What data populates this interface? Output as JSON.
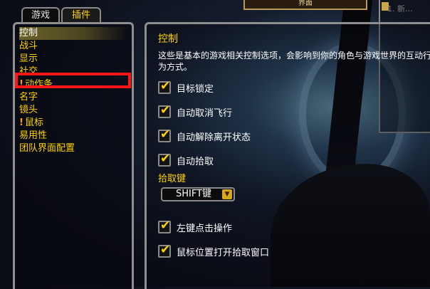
{
  "top_strip": {
    "center_label": "界面",
    "mini_frame_title": "1. 新..."
  },
  "tabs": [
    {
      "label": "游戏"
    },
    {
      "label": "插件"
    }
  ],
  "categories": [
    {
      "label": "控制"
    },
    {
      "label": "战斗"
    },
    {
      "label": "显示"
    },
    {
      "label": "社交"
    },
    {
      "label": "动作条"
    },
    {
      "label": "名字"
    },
    {
      "label": "镜头"
    },
    {
      "label": "鼠标"
    },
    {
      "label": "易用性"
    },
    {
      "label": "团队界面配置"
    }
  ],
  "warning_glyph": "!",
  "panel": {
    "title": "控制",
    "description": "这些是基本的游戏相关控制选项，会影响到你的角色与游戏世界的互动行为方式。",
    "options": [
      {
        "label": "目标锁定",
        "checked": true
      },
      {
        "label": "自动取消飞行",
        "checked": true
      },
      {
        "label": "自动解除离开状态",
        "checked": true
      },
      {
        "label": "自动拾取",
        "checked": true
      }
    ],
    "loot_key_label": "拾取键",
    "loot_key_value": "SHIFT键",
    "options2": [
      {
        "label": "左键点击操作",
        "checked": true
      },
      {
        "label": "鼠标位置打开拾取窗口",
        "checked": true
      }
    ]
  },
  "colors": {
    "accent": "#ffd200",
    "highlight_box": "#ff1515",
    "selected_text": "#ffffff"
  }
}
